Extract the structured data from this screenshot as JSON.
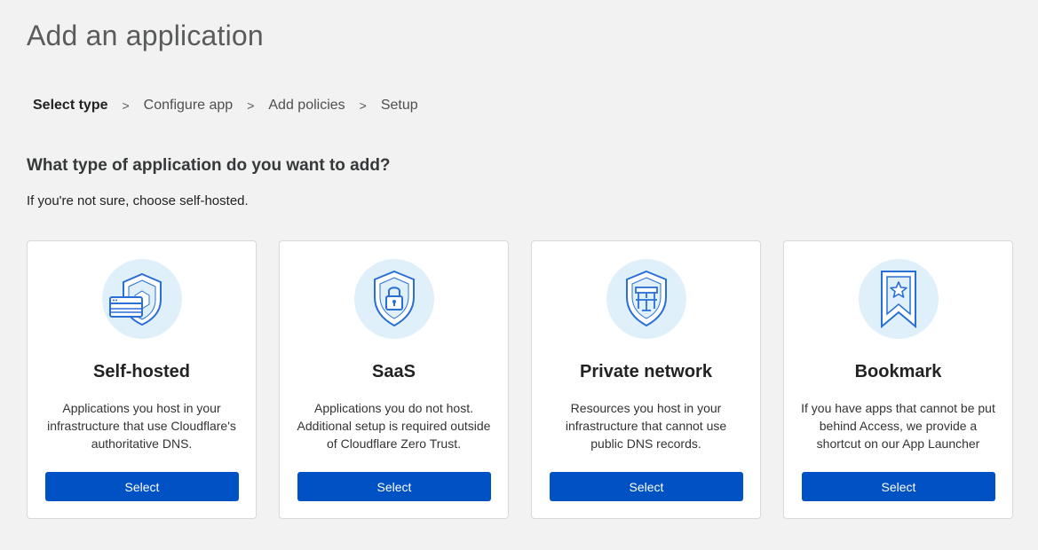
{
  "page": {
    "title": "Add an application"
  },
  "breadcrumb": {
    "steps": [
      "Select type",
      "Configure app",
      "Add policies",
      "Setup"
    ],
    "separator": ">"
  },
  "prompt": {
    "question": "What type of application do you want to add?",
    "hint": "If you're not sure, choose self-hosted."
  },
  "accent_color": "#0051c3",
  "icon_bg_color": "#dff0fa",
  "cards": [
    {
      "icon": "shield-with-card-icon",
      "title": "Self-hosted",
      "description": "Applications you host in your infrastructure that use Cloudflare's authoritative DNS.",
      "button": "Select"
    },
    {
      "icon": "shield-with-lock-icon",
      "title": "SaaS",
      "description": "Applications you do not host. Additional setup is required outside of Cloudflare Zero Trust.",
      "button": "Select"
    },
    {
      "icon": "shield-with-network-icon",
      "title": "Private network",
      "description": "Resources you host in your infrastructure that cannot use public DNS records.",
      "button": "Select"
    },
    {
      "icon": "bookmark-star-icon",
      "title": "Bookmark",
      "description": "If you have apps that cannot be put behind Access, we provide a shortcut on our App Launcher",
      "button": "Select"
    }
  ]
}
